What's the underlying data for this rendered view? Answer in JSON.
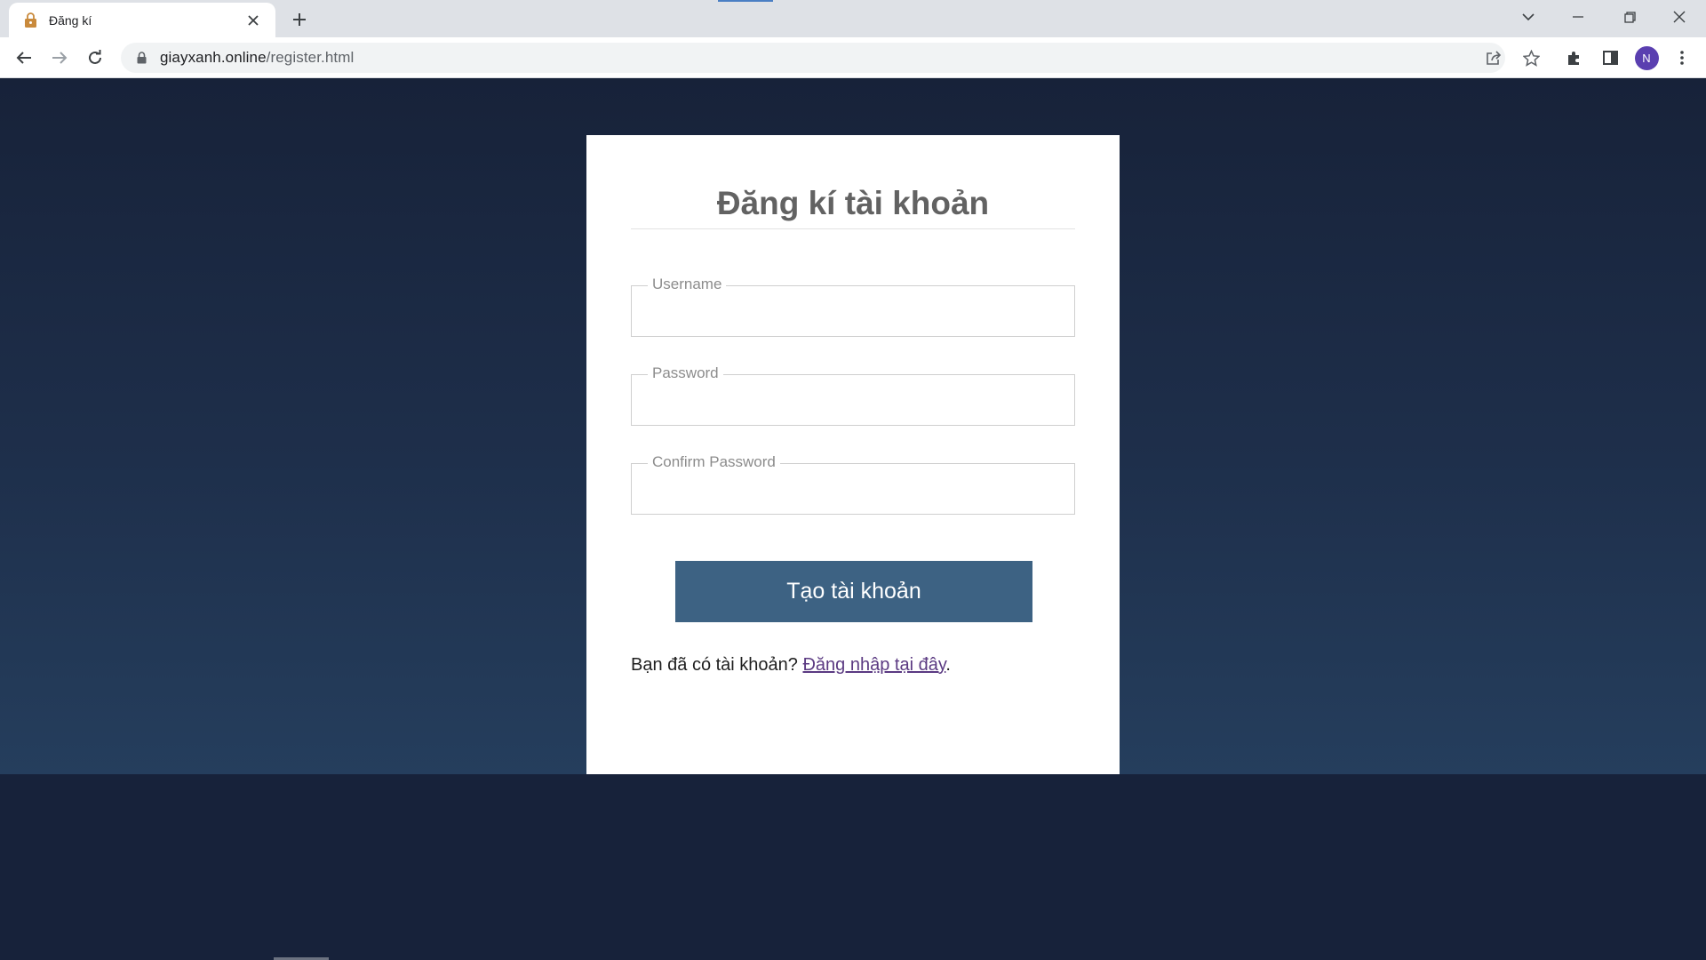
{
  "browser": {
    "tab_title": "Đăng kí",
    "url_host": "giayxanh.online",
    "url_path": "/register.html",
    "avatar_letter": "N"
  },
  "form": {
    "title": "Đăng kí tài khoản",
    "fields": [
      {
        "legend": "Username",
        "value": ""
      },
      {
        "legend": "Password",
        "value": ""
      },
      {
        "legend": "Confirm Password",
        "value": ""
      }
    ],
    "submit_label": "Tạo tài khoản",
    "login_prompt": "Bạn đã có tài khoản? ",
    "login_link": "Đăng nhập tại đây",
    "login_suffix": "."
  },
  "colors": {
    "background": "#17223a",
    "button": "#3d6283",
    "link": "#5b3a82",
    "avatar": "#5a3fb0"
  }
}
